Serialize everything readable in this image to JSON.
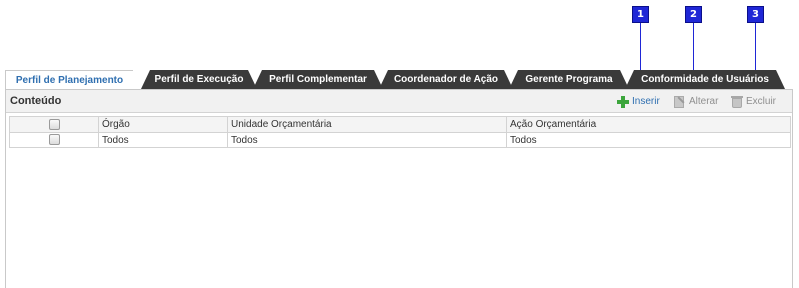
{
  "callouts": [
    "1",
    "2",
    "3"
  ],
  "tabs": [
    {
      "label": "Perfil de Planejamento",
      "active": true
    },
    {
      "label": "Perfil de Execução",
      "active": false
    },
    {
      "label": "Perfil Complementar",
      "active": false
    },
    {
      "label": "Coordenador de Ação",
      "active": false
    },
    {
      "label": "Gerente Programa",
      "active": false
    },
    {
      "label": "Conformidade de Usuários",
      "active": false
    }
  ],
  "panel": {
    "title": "Conteúdo",
    "toolbar": {
      "insert_label": "Inserir",
      "edit_label": "Alterar",
      "delete_label": "Excluir"
    }
  },
  "table": {
    "columns": [
      "Órgão",
      "Unidade Orçamentária",
      "Ação Orçamentária"
    ],
    "rows": [
      [
        "Todos",
        "Todos",
        "Todos"
      ]
    ]
  },
  "colors": {
    "accent": "#2f6fb0",
    "tab_dark": "#3a3a3a",
    "callout": "#1f27d6",
    "insert_icon": "#3ca53c"
  }
}
